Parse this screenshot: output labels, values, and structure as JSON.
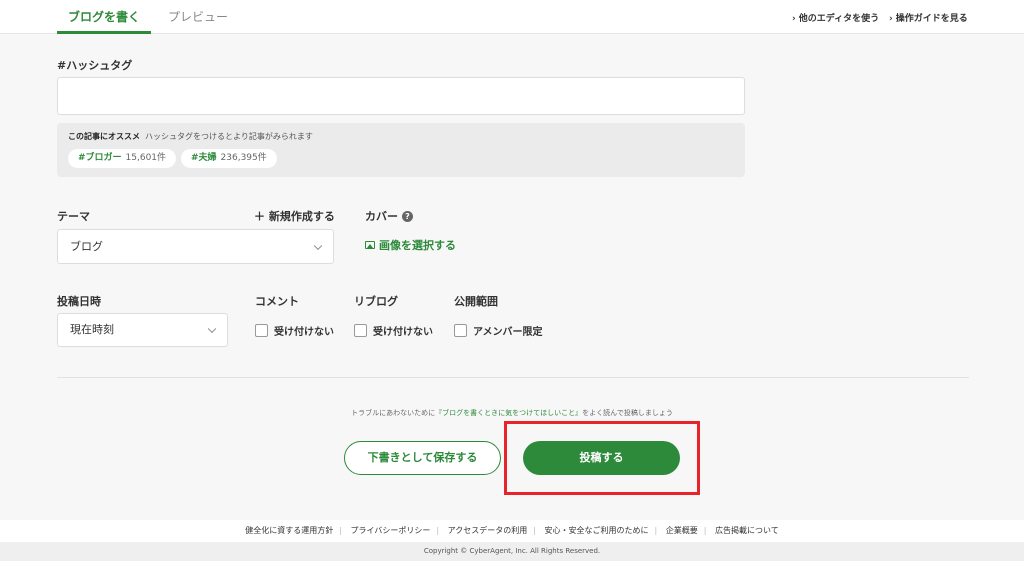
{
  "header": {
    "tab_write": "ブログを書く",
    "tab_preview": "プレビュー",
    "link_other_editor": "他のエディタを使う",
    "link_guide": "操作ガイドを見る"
  },
  "hashtag": {
    "label": "#ハッシュタグ",
    "value": "",
    "recommend_title": "この記事にオススメ",
    "recommend_text": "ハッシュタグをつけるとより記事がみられます",
    "chips": [
      {
        "tag": "#ブロガー",
        "count": "15,601件"
      },
      {
        "tag": "#夫婦",
        "count": "236,395件"
      }
    ]
  },
  "theme": {
    "label": "テーマ",
    "new_label": "新規作成する",
    "selected": "ブログ"
  },
  "cover": {
    "label": "カバー",
    "help": "?",
    "select_label": "画像を選択する"
  },
  "post_date": {
    "label": "投稿日時",
    "selected": "現在時刻"
  },
  "comment": {
    "label": "コメント",
    "option": "受け付けない"
  },
  "reblog": {
    "label": "リブログ",
    "option": "受け付けない"
  },
  "visibility": {
    "label": "公開範囲",
    "option": "アメンバー限定"
  },
  "notice": {
    "before": "トラブルにあわないために",
    "link": "『ブログを書くときに気をつけてほしいこと』",
    "after": "をよく読んで投稿しましょう"
  },
  "actions": {
    "draft": "下書きとして保存する",
    "post": "投稿する"
  },
  "footer": {
    "links": [
      "健全化に資する運用方針",
      "プライバシーポリシー",
      "アクセスデータの利用",
      "安心・安全なご利用のために",
      "企業概要",
      "広告掲載について"
    ],
    "copyright": "Copyright © CyberAgent, Inc. All Rights Reserved."
  },
  "colors": {
    "accent": "#2d8a3a",
    "highlight": "#e8232a"
  }
}
